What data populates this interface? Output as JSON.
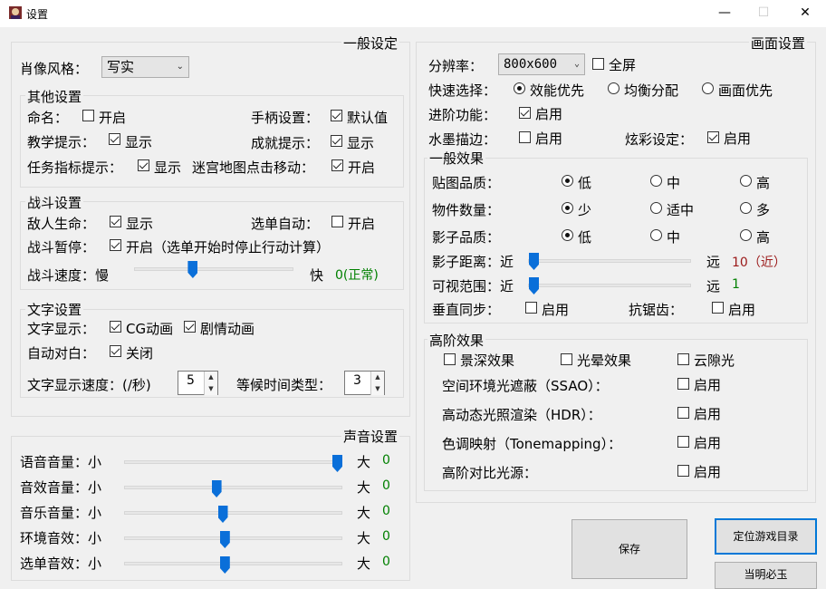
{
  "window": {
    "title": "设置",
    "minimize": "—",
    "maximize": "☐",
    "close": "✕"
  },
  "general": {
    "title": "一般设定",
    "portrait_label": "肖像风格：",
    "portrait_value": "写实",
    "other": {
      "title": "其他设置",
      "naming_label": "命名：",
      "naming_option": "开启",
      "gamepad_label": "手柄设置：",
      "gamepad_option": "默认值",
      "tutorial_label": "教学提示：",
      "tutorial_option": "显示",
      "achievement_label": "成就提示：",
      "achievement_option": "显示",
      "task_label": "任务指标提示：",
      "task_option": "显示",
      "maze_label": "迷宫地图点击移动：",
      "maze_option": "开启"
    },
    "battle": {
      "title": "战斗设置",
      "enemy_hp_label": "敌人生命：",
      "enemy_hp_option": "显示",
      "auto_select_label": "选单自动：",
      "auto_select_option": "开启",
      "pause_label": "战斗暂停：",
      "pause_option": "开启（选单开始时停止行动计算）",
      "speed_label": "战斗速度：慢",
      "speed_fast": "快",
      "speed_value": "0(正常)",
      "speed_position": 0.36
    },
    "text": {
      "title": "文字设置",
      "display_label": "文字显示：",
      "cg_option": "CG动画",
      "story_option": "剧情动画",
      "auto_dialog_label": "自动对白：",
      "auto_dialog_option": "关闭",
      "speed_label": "文字显示速度：(/秒)",
      "speed_value": "5",
      "wait_label": "等候时间类型：",
      "wait_value": "3"
    }
  },
  "sound": {
    "title": "声音设置",
    "items": [
      {
        "label": "语音音量：小",
        "max": "大",
        "value": "0",
        "level": 1.0
      },
      {
        "label": "音效音量：小",
        "max": "大",
        "value": "0",
        "level": 0.42
      },
      {
        "label": "音乐音量：小",
        "max": "大",
        "value": "0",
        "level": 0.45
      },
      {
        "label": "环境音效：小",
        "max": "大",
        "value": "0",
        "level": 0.46
      },
      {
        "label": "选单音效：小",
        "max": "大",
        "value": "0",
        "level": 0.46
      }
    ]
  },
  "display": {
    "title": "画面设置",
    "resolution_label": "分辨率：",
    "resolution_value": "800x600",
    "fullscreen_option": "全屏",
    "quick_label": "快速选择：",
    "quick_options": [
      "效能优先",
      "均衡分配",
      "画面优先"
    ],
    "advanced_label": "进阶功能：",
    "advanced_option": "启用",
    "ink_label": "水墨描边：",
    "ink_option": "启用",
    "color_label": "炫彩设定：",
    "color_option": "启用",
    "effects": {
      "title": "一般效果",
      "texture_label": "贴图品质：",
      "texture_options": [
        "低",
        "中",
        "高"
      ],
      "objects_label": "物件数量：",
      "objects_options": [
        "少",
        "适中",
        "多"
      ],
      "shadow_label": "影子品质：",
      "shadow_options": [
        "低",
        "中",
        "高"
      ],
      "shadow_dist_label": "影子距离：近",
      "shadow_dist_far": "远",
      "shadow_dist_value": "10（近）",
      "shadow_dist_position": 0.0,
      "view_label": "可视范围：近",
      "view_far": "远",
      "view_value": "1",
      "view_position": 0.0,
      "vsync_label": "垂直同步：",
      "vsync_option": "启用",
      "aa_label": "抗锯齿：",
      "aa_option": "启用"
    },
    "high": {
      "title": "高阶效果",
      "dof": "景深效果",
      "bloom": "光晕效果",
      "godray": "云隙光",
      "ssao_label": "空间环境光遮蔽（SSAO）：",
      "ssao_option": "启用",
      "hdr_label": "高动态光照渲染（HDR）：",
      "hdr_option": "启用",
      "tone_label": "色调映射（Tonemapping）：",
      "tone_option": "启用",
      "contrast_label": "高阶对比光源：",
      "contrast_option": "启用"
    }
  },
  "buttons": {
    "save": "保存",
    "locate": "定位游戏目录",
    "bottom": "当明必玉"
  }
}
